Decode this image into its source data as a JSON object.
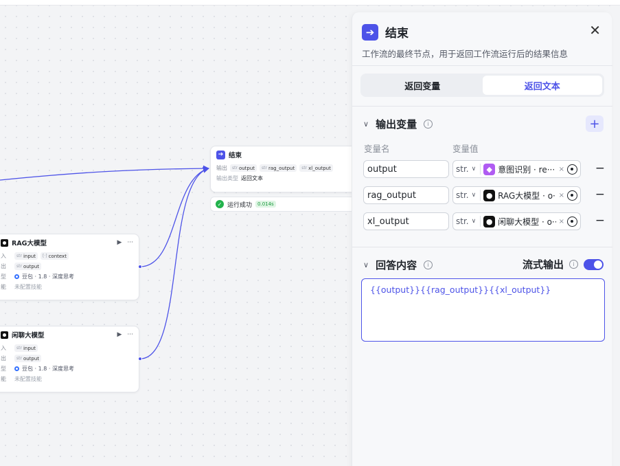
{
  "canvas": {
    "end_node": {
      "title": "结束",
      "output_label": "输出",
      "outputs": [
        {
          "type": "str",
          "name": "output"
        },
        {
          "type": "str",
          "name": "rag_output"
        },
        {
          "type": "str",
          "name": "xl_output"
        }
      ],
      "output_type_label": "输出类型",
      "output_type_value": "返回文本"
    },
    "run_status": {
      "text": "运行成功",
      "duration": "0.014s"
    },
    "rag_node": {
      "title": "RAG大模型",
      "run_icon": "▶",
      "more_icon": "···",
      "input_label": "入",
      "inputs": [
        {
          "type": "str",
          "name": "input"
        },
        {
          "type": "[·]",
          "name": "context"
        }
      ],
      "output_label": "出",
      "output": {
        "type": "str",
        "name": "output"
      },
      "model_label": "型",
      "model": "豆包 · 1.8 · 深度思考",
      "skill_label": "能",
      "skill": "未配置技能"
    },
    "chat_node": {
      "title": "闲聊大模型",
      "run_icon": "▶",
      "more_icon": "···",
      "input_label": "入",
      "input": {
        "type": "str",
        "name": "input"
      },
      "output_label": "出",
      "output": {
        "type": "str",
        "name": "output"
      },
      "model_label": "型",
      "model": "豆包 · 1.8 · 深度思考",
      "skill_label": "能",
      "skill": "未配置技能"
    }
  },
  "panel": {
    "title": "结束",
    "close": "✕",
    "description": "工作流的最终节点，用于返回工作流运行后的结果信息",
    "tabs": [
      {
        "label": "返回变量",
        "active": false
      },
      {
        "label": "返回文本",
        "active": true
      }
    ],
    "output_section": {
      "title": "输出变量",
      "info": "i",
      "add": "+",
      "col_name": "变量名",
      "col_value": "变量值",
      "rows": [
        {
          "name": "output",
          "type": "str.",
          "source": "意图识别 · re···",
          "icon": "intent-icon",
          "icon_color": "#b05cf2"
        },
        {
          "name": "rag_output",
          "type": "str.",
          "source": "RAG大模型 · o···",
          "icon": "llm-icon",
          "icon_color": "#111111"
        },
        {
          "name": "xl_output",
          "type": "str.",
          "source": "闲聊大模型 · o···",
          "icon": "llm-icon",
          "icon_color": "#111111"
        }
      ],
      "row_clear": "×",
      "row_remove": "−"
    },
    "answer_section": {
      "title": "回答内容",
      "info": "i",
      "stream_label": "流式输出",
      "stream_enabled": true,
      "content": "{{output}}{{rag_output}}{{xl_output}}"
    }
  },
  "colors": {
    "accent": "#4d53e8",
    "success": "#22b24c"
  }
}
